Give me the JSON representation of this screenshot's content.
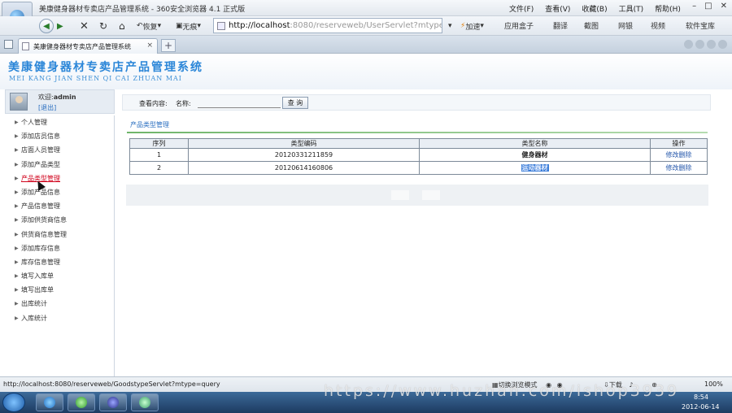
{
  "window": {
    "title": "美康健身器材专卖店产品管理系统 - 360安全浏览器 4.1 正式版",
    "menu": [
      "文件(F)",
      "查看(V)",
      "收藏(B)",
      "工具(T)",
      "帮助(H)"
    ]
  },
  "toolbar": {
    "back_label": "恢复",
    "trace_label": "无痕",
    "address_host": "http://localhost",
    "address_rest": ":8080/reserveweb/UserServlet?mtype=login",
    "accelerate_label": "加速",
    "right_items": [
      "应用盒子",
      "翻译",
      "截图",
      "网银",
      "视频",
      "软件宝库"
    ]
  },
  "tab": {
    "title": "美康健身器材专卖店产品管理系统"
  },
  "site": {
    "title": "美康健身器材专卖店产品管理系统",
    "subtitle": "MEI KANG JIAN SHEN QI CAI ZHUAN MAI"
  },
  "user": {
    "greeting_prefix": "欢迎:",
    "username": "admin",
    "logout_label": "[退出]"
  },
  "sidebar": {
    "items": [
      {
        "label": "个人管理",
        "active": false
      },
      {
        "label": "添加店员信息",
        "active": false
      },
      {
        "label": "店面人员管理",
        "active": false
      },
      {
        "label": "添加产品类型",
        "active": false
      },
      {
        "label": "产品类型管理",
        "active": true
      },
      {
        "label": "添加产品信息",
        "active": false
      },
      {
        "label": "产品信息管理",
        "active": false
      },
      {
        "label": "添加供货商信息",
        "active": false
      },
      {
        "label": "供货商信息管理",
        "active": false
      },
      {
        "label": "添加库存信息",
        "active": false
      },
      {
        "label": "库存信息管理",
        "active": false
      },
      {
        "label": "填写入库单",
        "active": false
      },
      {
        "label": "填写出库单",
        "active": false
      },
      {
        "label": "出库统计",
        "active": false
      },
      {
        "label": "入库统计",
        "active": false
      }
    ]
  },
  "search": {
    "label": "查看内容:",
    "name_label": "名称:",
    "name_value": "",
    "button_label": "查 询"
  },
  "section": {
    "title": "产品类型管理"
  },
  "table": {
    "headers": [
      "序列",
      "类型编码",
      "类型名称",
      "操作"
    ],
    "rows": [
      {
        "index": "1",
        "code": "20120331211859",
        "name": "健身器材",
        "edit": "修改",
        "delete": "删除"
      },
      {
        "index": "2",
        "code": "20120614160806",
        "name": "运动器材",
        "edit": "修改",
        "delete": "删除"
      }
    ]
  },
  "status": {
    "url": "http://localhost:8080/reserveweb/GoodstypeServlet?mtype=query",
    "mode_label": "切换浏览模式",
    "download_label": "下载",
    "zoom": "100%"
  },
  "taskbar": {
    "time": "8:54",
    "date": "2012-06-14"
  },
  "watermark": "https://www.huzhan.com/ishop3939"
}
